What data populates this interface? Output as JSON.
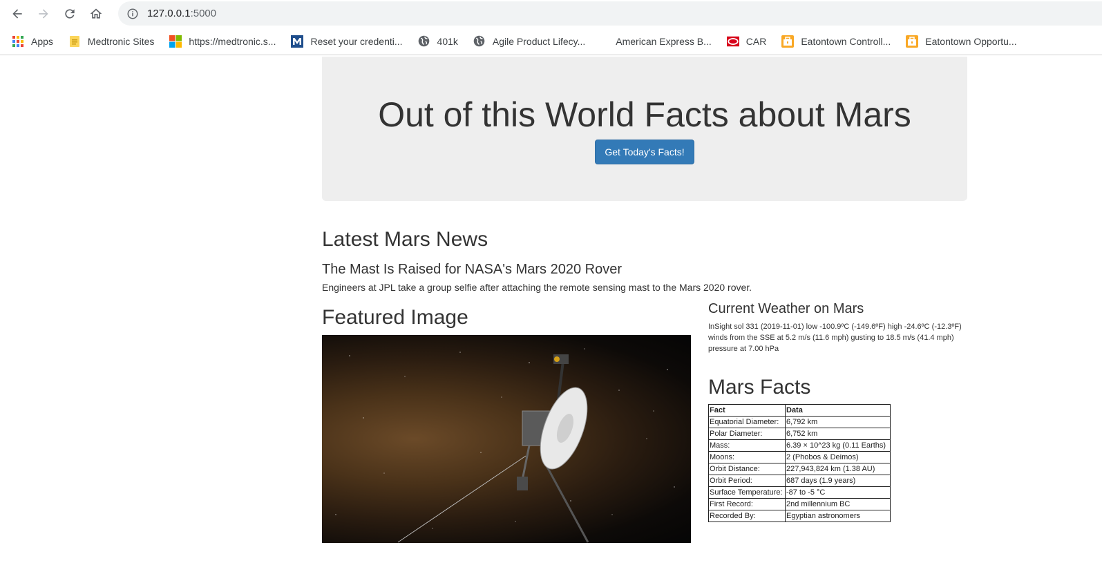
{
  "browser": {
    "url_host": "127.0.0.1",
    "url_port": ":5000",
    "icons": [
      "back-icon",
      "forward-icon",
      "reload-icon",
      "home-icon",
      "info-icon"
    ]
  },
  "bookmarks": [
    {
      "label": "Apps",
      "icon": "apps-grid-icon"
    },
    {
      "label": "Medtronic Sites",
      "icon": "folder-icon"
    },
    {
      "label": "https://medtronic.s...",
      "icon": "microsoft-icon"
    },
    {
      "label": "Reset your credenti...",
      "icon": "m-logo-icon"
    },
    {
      "label": "401k",
      "icon": "globe-icon"
    },
    {
      "label": "Agile Product Lifecy...",
      "icon": "globe-icon"
    },
    {
      "label": "American Express B...",
      "icon": ""
    },
    {
      "label": "CAR",
      "icon": "car-icon"
    },
    {
      "label": "Eatontown Controll...",
      "icon": "briefcase-icon"
    },
    {
      "label": "Eatontown Opportu...",
      "icon": "briefcase-icon"
    }
  ],
  "page": {
    "title": "Out of this World Facts about Mars",
    "button_label": "Get Today's Facts!",
    "news": {
      "heading": "Latest Mars News",
      "title": "The Mast Is Raised for NASA's Mars 2020 Rover",
      "paragraph": "Engineers at JPL take a group selfie after attaching the remote sensing mast to the Mars 2020 rover."
    },
    "featured": {
      "heading": "Featured Image"
    },
    "weather": {
      "heading": "Current Weather on Mars",
      "text": "InSight sol 331 (2019-11-01) low -100.9ºC (-149.6ºF) high -24.6ºC (-12.3ºF) winds from the SSE at 5.2 m/s (11.6 mph) gusting to 18.5 m/s (41.4 mph) pressure at 7.00 hPa"
    },
    "facts": {
      "heading": "Mars Facts",
      "columns": [
        "Fact",
        "Data"
      ],
      "rows": [
        [
          "Equatorial Diameter:",
          "6,792 km"
        ],
        [
          "Polar Diameter:",
          "6,752 km"
        ],
        [
          "Mass:",
          "6.39 × 10^23 kg (0.11 Earths)"
        ],
        [
          "Moons:",
          "2 (Phobos & Deimos)"
        ],
        [
          "Orbit Distance:",
          "227,943,824 km (1.38 AU)"
        ],
        [
          "Orbit Period:",
          "687 days (1.9 years)"
        ],
        [
          "Surface Temperature:",
          "-87 to -5 °C"
        ],
        [
          "First Record:",
          "2nd millennium BC"
        ],
        [
          "Recorded By:",
          "Egyptian astronomers"
        ]
      ]
    }
  },
  "colors": {
    "primary_button": "#337ab7",
    "jumbotron_bg": "#eeeeee"
  }
}
